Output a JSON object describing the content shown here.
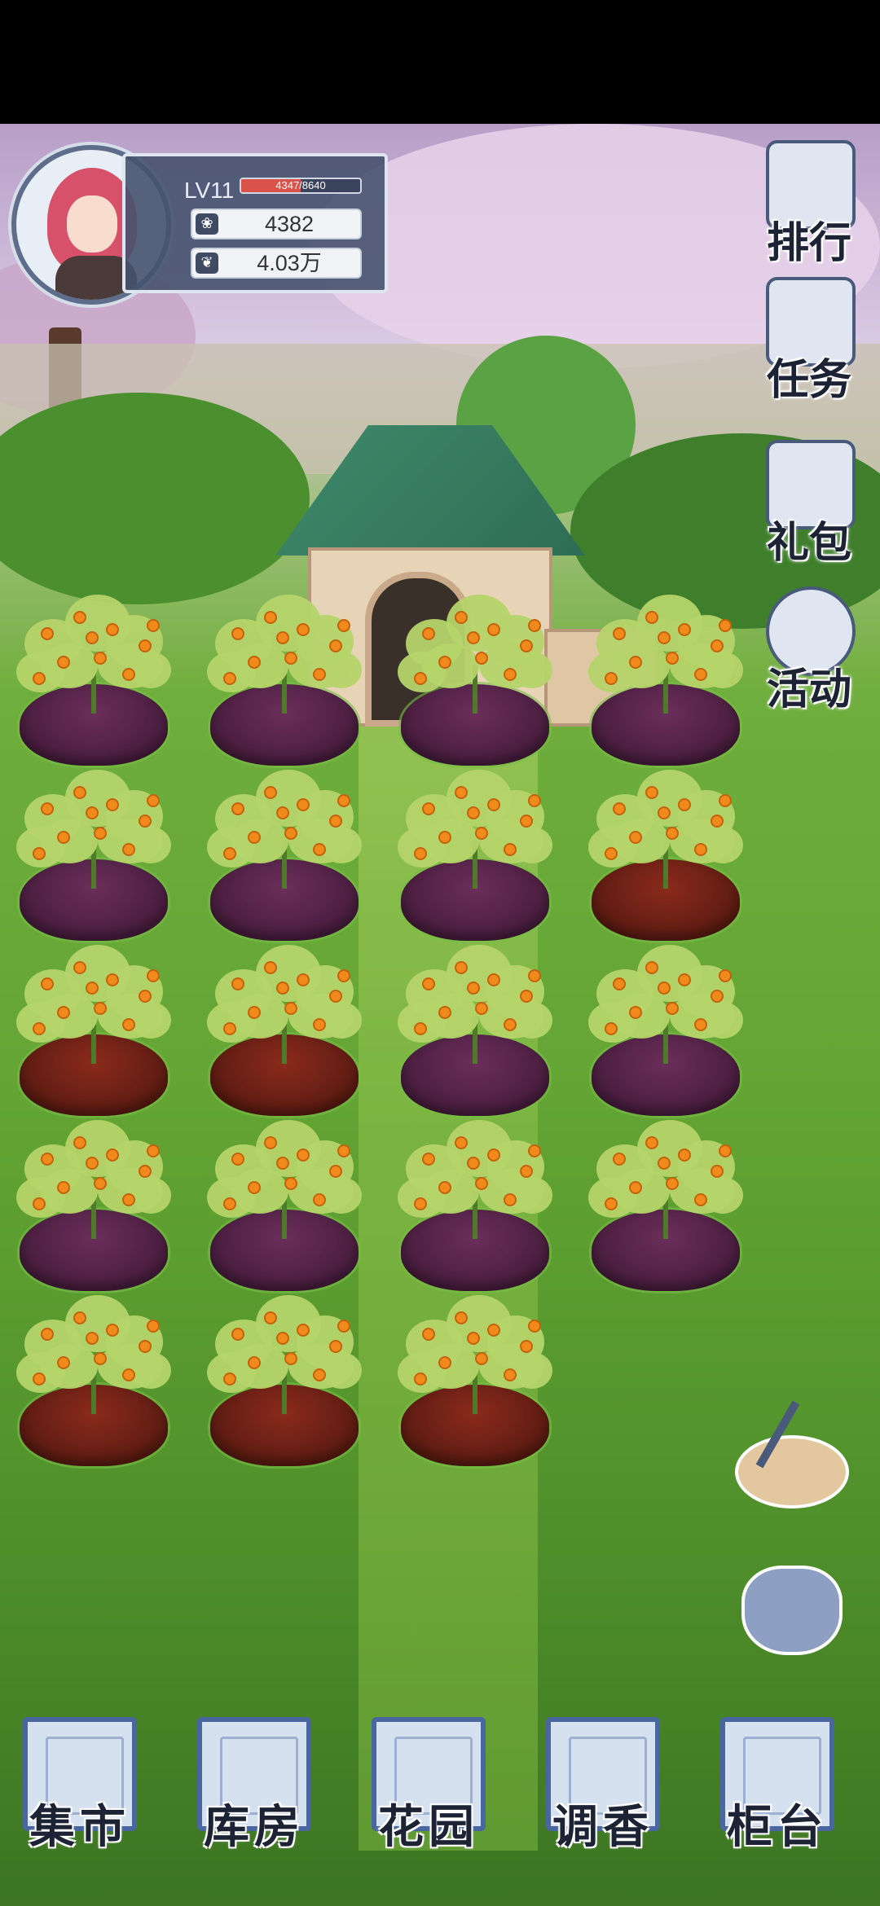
{
  "player": {
    "level_label": "LV11",
    "xp_text": "4347/8640",
    "xp_fraction": 0.503,
    "petals": "4382",
    "coins": "4.03万"
  },
  "side_menu": [
    {
      "label": "排行",
      "icon": "ranking-icon"
    },
    {
      "label": "任务",
      "icon": "task-scroll-icon"
    },
    {
      "label": "礼包",
      "icon": "gift-box-icon"
    },
    {
      "label": "活动",
      "icon": "event-globe-icon"
    }
  ],
  "tools": [
    {
      "icon": "shovel-icon"
    },
    {
      "icon": "seed-bag-icon"
    }
  ],
  "garden": {
    "rows": [
      [
        "purple",
        "purple",
        "purple",
        "purple"
      ],
      [
        "purple",
        "purple",
        "purple",
        "red"
      ],
      [
        "red",
        "red",
        "purple",
        "purple"
      ],
      [
        "purple",
        "purple",
        "purple",
        "purple"
      ],
      [
        "red",
        "red",
        "red"
      ]
    ]
  },
  "bottom_nav": [
    {
      "label": "集市",
      "icon": "market-gate-icon"
    },
    {
      "label": "库房",
      "icon": "warehouse-icon"
    },
    {
      "label": "花园",
      "icon": "rose-icon"
    },
    {
      "label": "调香",
      "icon": "perfume-bottle-icon"
    },
    {
      "label": "柜台",
      "icon": "counter-icon"
    }
  ],
  "colors": {
    "soil_purple": "#4a1e3f",
    "soil_red": "#5e1c12",
    "orange_fruit": "#f08a1c",
    "ui_blue": "#4a66a0"
  }
}
